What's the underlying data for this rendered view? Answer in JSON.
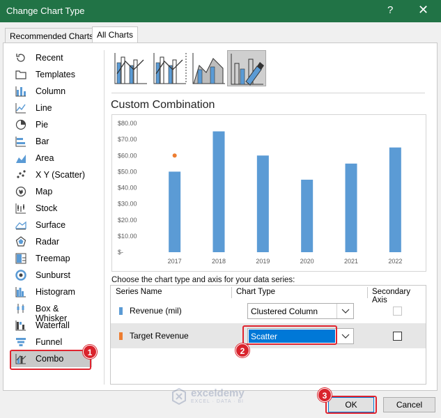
{
  "window": {
    "title": "Change Chart Type",
    "help_label": "?",
    "close_label": "✕"
  },
  "tabs": [
    {
      "label": "Recommended Charts",
      "active": false
    },
    {
      "label": "All Charts",
      "active": true
    }
  ],
  "sidebar": {
    "items": [
      {
        "label": "Recent",
        "icon": "recent-icon"
      },
      {
        "label": "Templates",
        "icon": "templates-icon"
      },
      {
        "label": "Column",
        "icon": "column-icon"
      },
      {
        "label": "Line",
        "icon": "line-icon"
      },
      {
        "label": "Pie",
        "icon": "pie-icon"
      },
      {
        "label": "Bar",
        "icon": "bar-icon"
      },
      {
        "label": "Area",
        "icon": "area-icon"
      },
      {
        "label": "X Y (Scatter)",
        "icon": "scatter-icon"
      },
      {
        "label": "Map",
        "icon": "map-icon"
      },
      {
        "label": "Stock",
        "icon": "stock-icon"
      },
      {
        "label": "Surface",
        "icon": "surface-icon"
      },
      {
        "label": "Radar",
        "icon": "radar-icon"
      },
      {
        "label": "Treemap",
        "icon": "treemap-icon"
      },
      {
        "label": "Sunburst",
        "icon": "sunburst-icon"
      },
      {
        "label": "Histogram",
        "icon": "histogram-icon"
      },
      {
        "label": "Box & Whisker",
        "icon": "box-whisker-icon"
      },
      {
        "label": "Waterfall",
        "icon": "waterfall-icon"
      },
      {
        "label": "Funnel",
        "icon": "funnel-icon"
      },
      {
        "label": "Combo",
        "icon": "combo-icon",
        "selected": true
      }
    ]
  },
  "main": {
    "heading": "Custom Combination",
    "choose_label": "Choose the chart type and axis for your data series:",
    "columns": {
      "series_name": "Series Name",
      "chart_type": "Chart Type",
      "secondary_axis": "Secondary Axis"
    },
    "series_rows": [
      {
        "name": "Revenue (mil)",
        "chart_type": "Clustered Column",
        "secondary_axis": false,
        "color": "#5b9bd5"
      },
      {
        "name": "Target Revenue",
        "chart_type": "Scatter",
        "secondary_axis": false,
        "color": "#ed7d31"
      }
    ]
  },
  "buttons": {
    "ok": "OK",
    "cancel": "Cancel"
  },
  "annotations": {
    "step1": "1",
    "step2": "2",
    "step3": "3"
  },
  "watermark": {
    "name": "exceldemy",
    "sub": "EXCEL · DATA · BI"
  },
  "colors": {
    "titlebar": "#217346",
    "accent": "#0078d7",
    "column": "#5b9bd5",
    "scatter": "#ed7d31",
    "annotation": "#e0242f"
  },
  "chart_data": {
    "type": "bar",
    "categories": [
      "2017",
      "2018",
      "2019",
      "2020",
      "2021",
      "2022"
    ],
    "series": [
      {
        "values": [
          50,
          75,
          60,
          45,
          55,
          65
        ],
        "kind": "column"
      },
      {
        "values": [
          60,
          null,
          null,
          null,
          null,
          null
        ],
        "kind": "scatter"
      }
    ],
    "ylim": [
      0,
      80
    ],
    "yticks": [
      "$-",
      "$10.00",
      "$20.00",
      "$30.00",
      "$40.00",
      "$50.00",
      "$60.00",
      "$70.00",
      "$80.00"
    ],
    "grid": false,
    "legend": "none"
  }
}
